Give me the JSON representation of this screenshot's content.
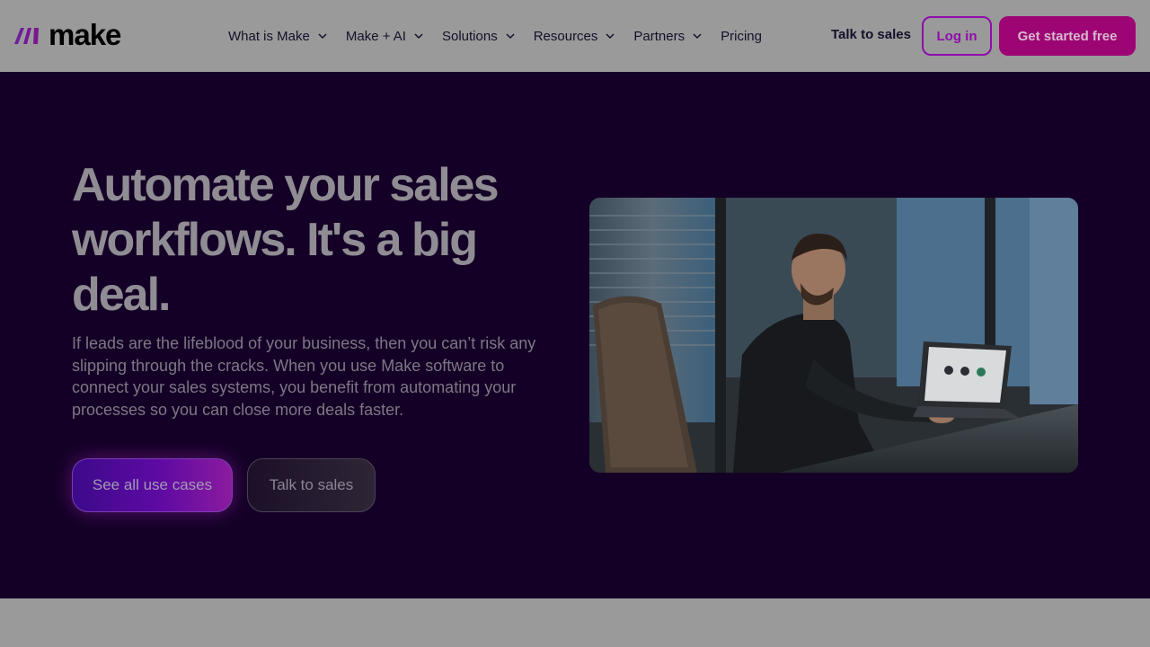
{
  "brand": {
    "name": "make"
  },
  "nav": {
    "items": [
      {
        "label": "What is Make",
        "has_dropdown": true
      },
      {
        "label": "Make + AI",
        "has_dropdown": true
      },
      {
        "label": "Solutions",
        "has_dropdown": true
      },
      {
        "label": "Resources",
        "has_dropdown": true
      },
      {
        "label": "Partners",
        "has_dropdown": true
      },
      {
        "label": "Pricing",
        "has_dropdown": false
      }
    ]
  },
  "header_actions": {
    "talk_to_sales": "Talk to sales",
    "login": "Log in",
    "get_started": "Get started free"
  },
  "hero": {
    "title": "Automate your sales workflows. It's a big deal.",
    "description": "If leads are the lifeblood of your business, then you can’t risk any slipping through the cracks. When you use Make software to connect your sales systems, you benefit from automating your processes so you can close more deals faster.",
    "primary_cta": "See all use cases",
    "secondary_cta": "Talk to sales"
  },
  "colors": {
    "hero_bg": "#140026",
    "accent": "#8e0dab",
    "cta": "#9d0574",
    "overlay": "#9a9a9a"
  }
}
